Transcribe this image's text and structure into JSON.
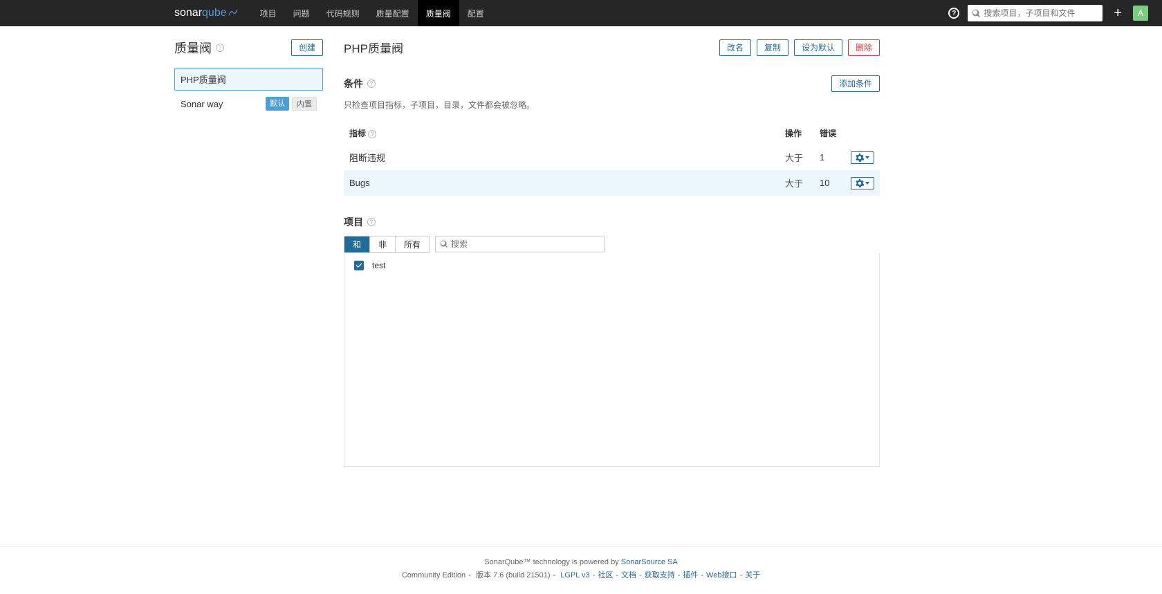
{
  "brand": {
    "part1": "sonar",
    "part2": "qube"
  },
  "nav": {
    "items": [
      "项目",
      "问题",
      "代码规则",
      "质量配置",
      "质量阀",
      "配置"
    ],
    "activeIndex": 4
  },
  "search": {
    "placeholder": "搜索项目，子项目和文件"
  },
  "avatar": {
    "initial": "A"
  },
  "sidebar": {
    "title": "质量阀",
    "createLabel": "创建",
    "gates": [
      {
        "name": "PHP质量阀",
        "selected": true,
        "default": false,
        "builtin": false
      },
      {
        "name": "Sonar way",
        "selected": false,
        "default": true,
        "builtin": true
      }
    ],
    "badges": {
      "default": "默认",
      "builtin": "内置"
    }
  },
  "main": {
    "title": "PHP质量阀",
    "actions": {
      "rename": "改名",
      "copy": "复制",
      "setDefault": "设为默认",
      "delete": "删除"
    }
  },
  "conditions": {
    "title": "条件",
    "addLabel": "添加条件",
    "note": "只检查项目指标，子项目，目录，文件都会被忽略。",
    "headers": {
      "metric": "指标",
      "operator": "操作",
      "error": "错误"
    },
    "rows": [
      {
        "metric": "阻断违规",
        "op": "大于",
        "error": "1"
      },
      {
        "metric": "Bugs",
        "op": "大于",
        "error": "10"
      }
    ]
  },
  "projects": {
    "title": "项目",
    "filters": {
      "withLabel": "和",
      "withoutLabel": "非",
      "allLabel": "所有",
      "activeIndex": 0
    },
    "searchPlaceholder": "搜索",
    "items": [
      {
        "name": "test",
        "checked": true
      }
    ]
  },
  "footer": {
    "line1_prefix": "SonarQube™ technology is powered by ",
    "line1_link": "SonarSource SA",
    "edition": "Community Edition",
    "version": "版本 7.6 (build 21501)",
    "links": [
      "LGPL v3",
      "社区",
      "文档",
      "获取支持",
      "插件",
      "Web接口",
      "关于"
    ]
  }
}
